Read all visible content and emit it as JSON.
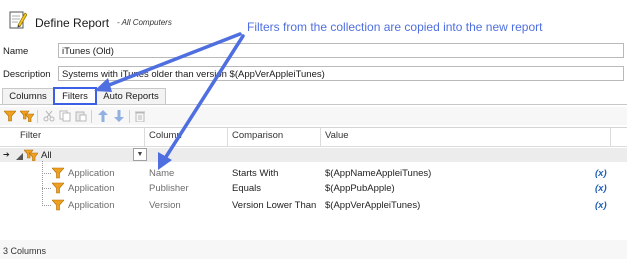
{
  "window": {
    "title": "Define Report",
    "subtitle": "- All Computers"
  },
  "annotation": {
    "text": "Filters from the collection are copied into the new report"
  },
  "form": {
    "name_label": "Name",
    "name_value": "iTunes (Old)",
    "description_label": "Description",
    "description_value": "Systems with iTunes older than version $(AppVerAppleiTunes)"
  },
  "tabs": [
    {
      "label": "Columns",
      "active": false
    },
    {
      "label": "Filters",
      "active": true
    },
    {
      "label": "Auto Reports",
      "active": false
    }
  ],
  "toolbar": {
    "buttons": [
      "add-filter-icon",
      "add-group-icon",
      "cut-icon",
      "copy-icon",
      "paste-icon",
      "move-up-icon",
      "move-down-icon",
      "delete-icon"
    ]
  },
  "grid": {
    "headers": [
      "Filter",
      "Column",
      "Comparison",
      "Value"
    ],
    "group": {
      "label": "All"
    },
    "rows": [
      {
        "filter": "Application",
        "column": "Name",
        "comparison": "Starts With",
        "value": "$(AppNameAppleiTunes)",
        "fx": "(x)"
      },
      {
        "filter": "Application",
        "column": "Publisher",
        "comparison": "Equals",
        "value": "$(AppPubApple)",
        "fx": "(x)"
      },
      {
        "filter": "Application",
        "column": "Version",
        "comparison": "Version Lower Than",
        "value": "$(AppVerAppleiTunes)",
        "fx": "(x)"
      }
    ]
  },
  "status": {
    "text": "3 Columns"
  },
  "colors": {
    "accent_blue": "#3d5fe6",
    "annotation_text": "#4f6fe0",
    "filter_icon": "#f0a020",
    "fx": "#1f5fb8"
  }
}
